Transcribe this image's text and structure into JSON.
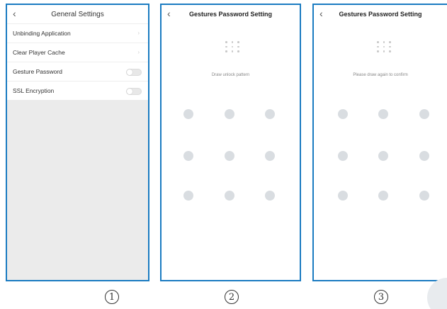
{
  "screen1": {
    "title": "General Settings",
    "back_icon": "chevron-left-icon",
    "items": [
      {
        "label": "Unbinding Application",
        "control": "chevron-right-icon"
      },
      {
        "label": "Clear Player Cache",
        "control": "chevron-right-icon"
      },
      {
        "label": "Gesture Password",
        "control": "toggle",
        "on": false
      },
      {
        "label": "SSL Encryption",
        "control": "toggle",
        "on": false
      }
    ],
    "step": "1"
  },
  "screen2": {
    "title": "Gestures Password Setting",
    "back_icon": "chevron-left-icon",
    "prompt": "Draw unlock pattern",
    "step": "2"
  },
  "screen3": {
    "title": "Gestures Password Setting",
    "back_icon": "chevron-left-icon",
    "prompt": "Please draw again to confirm",
    "step": "3"
  },
  "colors": {
    "frame_border": "#1a7bc1",
    "settings_background": "#ebebeb",
    "pattern_dot": "#d9dde1"
  }
}
